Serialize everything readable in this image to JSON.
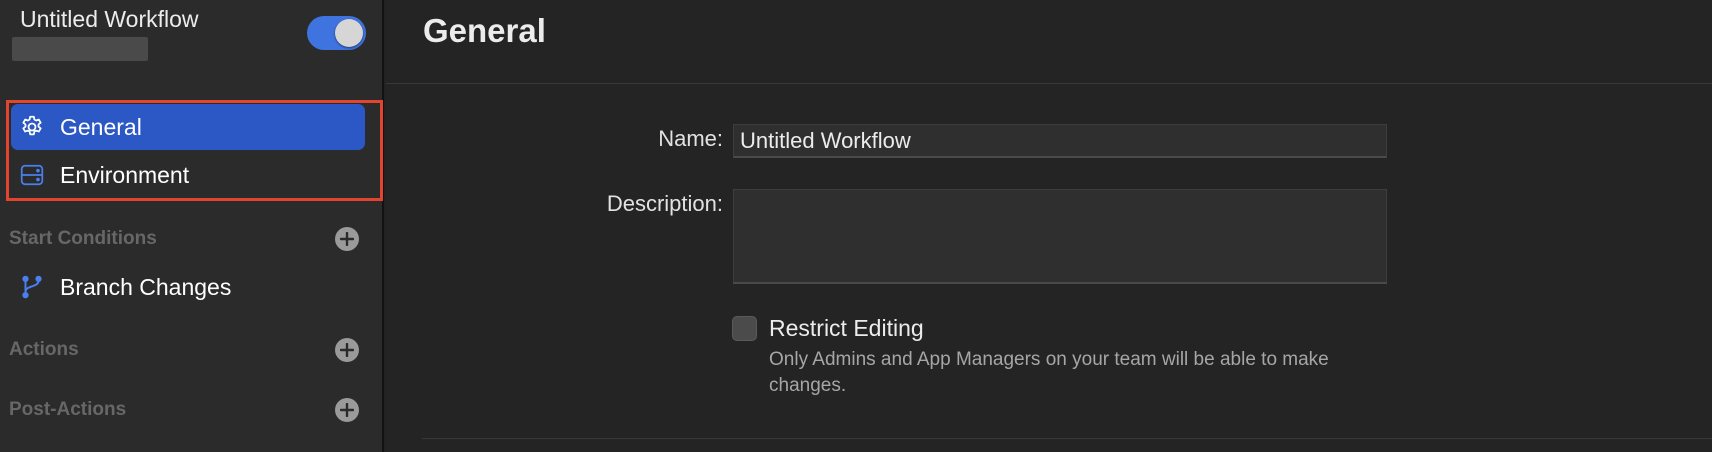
{
  "sidebar": {
    "workflow_title": "Untitled Workflow",
    "enabled": true,
    "nav": [
      {
        "label": "General",
        "icon": "gear-icon",
        "selected": true
      },
      {
        "label": "Environment",
        "icon": "server-icon",
        "selected": false
      }
    ],
    "sections": {
      "start_conditions": {
        "label": "Start Conditions",
        "items": [
          {
            "label": "Branch Changes",
            "icon": "branch-icon"
          }
        ]
      },
      "actions": {
        "label": "Actions"
      },
      "post_actions": {
        "label": "Post-Actions"
      }
    }
  },
  "main": {
    "title": "General",
    "name_label": "Name:",
    "name_value": "Untitled Workflow",
    "description_label": "Description:",
    "description_value": "",
    "restrict": {
      "label": "Restrict Editing",
      "checked": false,
      "help": "Only Admins and App Managers on your team will be able to make changes."
    }
  },
  "colors": {
    "accent": "#2b58c4",
    "toggle_on": "#3f74e0",
    "highlight": "#e2452f",
    "icon_blue": "#4a7ff0"
  }
}
